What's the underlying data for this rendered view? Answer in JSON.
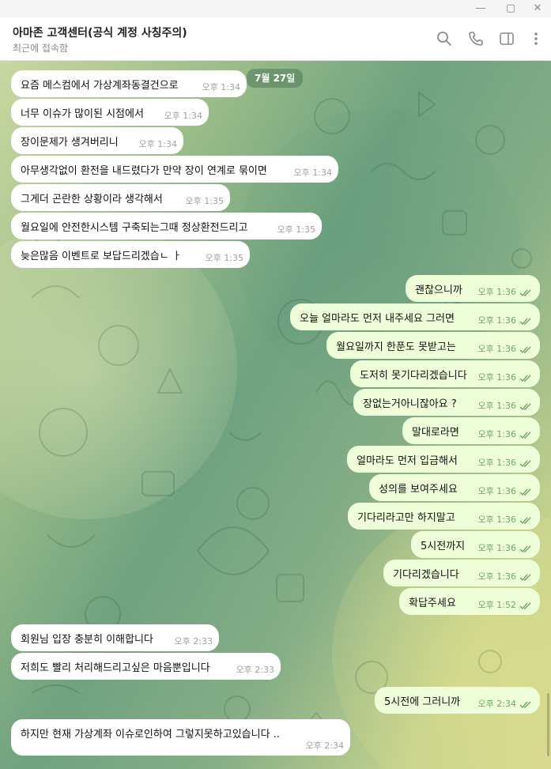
{
  "window": {
    "minimize_glyph": "—",
    "maximize_glyph": "▢",
    "close_glyph": "✕"
  },
  "header": {
    "title": "아마존 고객센터(공식 계정 사칭주의)",
    "status": "최근에 접속함",
    "icons": [
      "search-icon",
      "phone-icon",
      "sidebar-toggle-icon",
      "more-icon"
    ]
  },
  "date_pill": "7월 27일",
  "messages": [
    {
      "dir": "in",
      "text": "요즘 메스컴에서 가상계좌동결건으로",
      "time": "오후 1:34"
    },
    {
      "dir": "in",
      "text": "너무 이슈가 많이된 시점에서",
      "time": "오후 1:34"
    },
    {
      "dir": "in",
      "text": "장이문제가 생겨버리니",
      "time": "오후 1:34"
    },
    {
      "dir": "in",
      "text": "아무생각없이 환전을 내드렸다가 만약 장이 연계로 묶이면",
      "time": "오후 1:34"
    },
    {
      "dir": "in",
      "text": "그게더 곤란한 상황이라 생각해서",
      "time": "오후 1:35"
    },
    {
      "dir": "in",
      "text": "월요일에 안전한시스템 구축되는그때 정상환전드리고",
      "time": "오후 1:35"
    },
    {
      "dir": "in",
      "text": "늦은많음 이벤트로 보답드리겠습ㄴ ㅏ",
      "time": "오후 1:35"
    },
    {
      "dir": "out",
      "text": "괜찮으니까",
      "time": "오후 1:36"
    },
    {
      "dir": "out",
      "text": "오늘 얼마라도 먼저 내주세요 그러면",
      "time": "오후 1:36"
    },
    {
      "dir": "out",
      "text": "월요일까지 한푼도 못받고는",
      "time": "오후 1:36"
    },
    {
      "dir": "out",
      "text": "도저히 못기다리겠습니다",
      "time": "오후 1:36"
    },
    {
      "dir": "out",
      "text": "장없는거아니잖아요 ?",
      "time": "오후 1:36"
    },
    {
      "dir": "out",
      "text": "말대로라면",
      "time": "오후 1:36"
    },
    {
      "dir": "out",
      "text": "얼마라도 먼저 입금해서",
      "time": "오후 1:36"
    },
    {
      "dir": "out",
      "text": "성의를 보여주세요",
      "time": "오후 1:36"
    },
    {
      "dir": "out",
      "text": "기다리라고만 하지말고",
      "time": "오후 1:36"
    },
    {
      "dir": "out",
      "text": "5시전까지",
      "time": "오후 1:36"
    },
    {
      "dir": "out",
      "text": "기다리겠습니다",
      "time": "오후 1:36"
    },
    {
      "dir": "out",
      "text": "확답주세요",
      "time": "오후 1:52"
    },
    {
      "dir": "in",
      "text": "회원님 입장 충분히 이해합니다",
      "time": "오후 2:33"
    },
    {
      "dir": "in",
      "text": "저희도 빨리 처리해드리고싶은 마음뿐입니다",
      "time": "오후 2:33"
    },
    {
      "dir": "out",
      "text": "5시전에 그러니까",
      "time": "오후 2:34"
    },
    {
      "dir": "in",
      "text": "하지만 현재 가상계좌 이슈로인하여 그렇지못하고있습니다 ..",
      "time": "오후 2:34"
    }
  ],
  "colors": {
    "incoming": "#ffffff",
    "outgoing": "#eefed8",
    "time_out": "#6ba85f",
    "date_pill": "#5a8a66"
  }
}
